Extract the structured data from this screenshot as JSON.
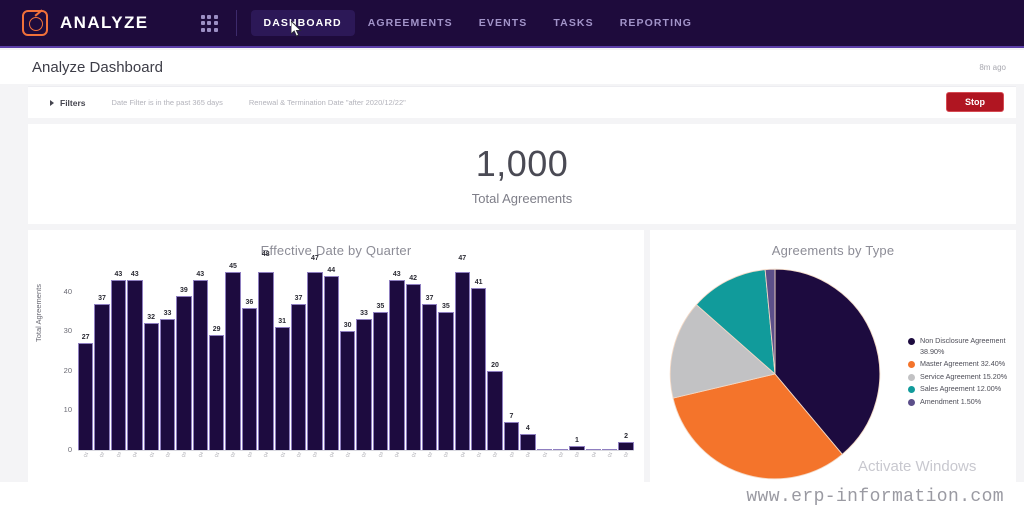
{
  "topnav": {
    "brand": "ANALYZE",
    "logo_icon": "analyze-gauge-logo-icon",
    "grid_icon": "apps-grid-icon",
    "logo_color": "#f1713a",
    "background": "#1e0b3c",
    "items": [
      {
        "label": "DASHBOARD",
        "active": true
      },
      {
        "label": "AGREEMENTS",
        "active": false
      },
      {
        "label": "EVENTS",
        "active": false
      },
      {
        "label": "TASKS",
        "active": false
      },
      {
        "label": "REPORTING",
        "active": false
      }
    ]
  },
  "titlebar": {
    "title": "Analyze Dashboard",
    "ago": "8m ago"
  },
  "filterbar": {
    "toggle_label": "Filters",
    "caret_icon": "caret-right-icon",
    "chips": [
      "Date Filter is in the past 365 days",
      "Renewal & Termination Date \"after 2020/12/22\""
    ],
    "stop_label": "Stop",
    "stop_color": "#b01521"
  },
  "kpi": {
    "value": "1,000",
    "label": "Total Agreements"
  },
  "panels": {
    "bar_title": "Effective Date by Quarter",
    "pie_title": "Agreements by Type"
  },
  "overlays": {
    "activate_windows": "Activate Windows",
    "watermark": "www.erp-information.com"
  },
  "chart_data": [
    {
      "type": "bar",
      "title": "Effective Date by Quarter",
      "xlabel": "",
      "ylabel": "Total Agreements",
      "ylim": [
        0,
        45
      ],
      "yticks": [
        0,
        10,
        20,
        30,
        40
      ],
      "grid": false,
      "bar_color": "#1d0b3f",
      "categories": [
        "Q1",
        "Q2",
        "Q3",
        "Q4",
        "Q1",
        "Q2",
        "Q3",
        "Q4",
        "Q1",
        "Q2",
        "Q3",
        "Q4",
        "Q1",
        "Q2",
        "Q3",
        "Q4",
        "Q1",
        "Q2",
        "Q3",
        "Q4",
        "Q1",
        "Q2",
        "Q3",
        "Q4",
        "Q1",
        "Q2",
        "Q3",
        "Q4",
        "Q1",
        "Q2",
        "Q3",
        "Q4",
        "Q1",
        "Q2"
      ],
      "values": [
        27,
        37,
        43,
        43,
        32,
        33,
        39,
        43,
        29,
        45,
        36,
        48,
        31,
        37,
        47,
        44,
        30,
        33,
        35,
        43,
        42,
        37,
        35,
        47,
        41,
        20,
        7,
        4,
        0,
        0,
        1,
        0,
        0,
        2
      ],
      "labels": [
        "27",
        "37",
        "43",
        "43",
        "32",
        "33",
        "39",
        "43",
        "29",
        "45",
        "36",
        "48",
        "31",
        "37",
        "47",
        "44",
        "30",
        "33",
        "35",
        "43",
        "42",
        "37",
        "35",
        "47",
        "41",
        "20",
        "7",
        "4",
        "",
        "",
        "1",
        "",
        "",
        "2"
      ]
    },
    {
      "type": "pie",
      "title": "Agreements by Type",
      "legend_position": "right",
      "slices": [
        {
          "name": "Non Disclosure Agreement",
          "value": 38.9,
          "label": "Non Disclosure Agreement 38.90%",
          "color": "#1d0b3f"
        },
        {
          "name": "Master Agreement",
          "value": 32.4,
          "label": "Master Agreement 32.40%",
          "color": "#f4742b"
        },
        {
          "name": "Service Agreement",
          "value": 15.2,
          "label": "Service Agreement 15.20%",
          "color": "#c2c2c4"
        },
        {
          "name": "Sales Agreement",
          "value": 12.0,
          "label": "Sales Agreement 12.00%",
          "color": "#119b9b"
        },
        {
          "name": "Amendment",
          "value": 1.5,
          "label": "Amendment 1.50%",
          "color": "#5c4f8a"
        }
      ]
    }
  ]
}
